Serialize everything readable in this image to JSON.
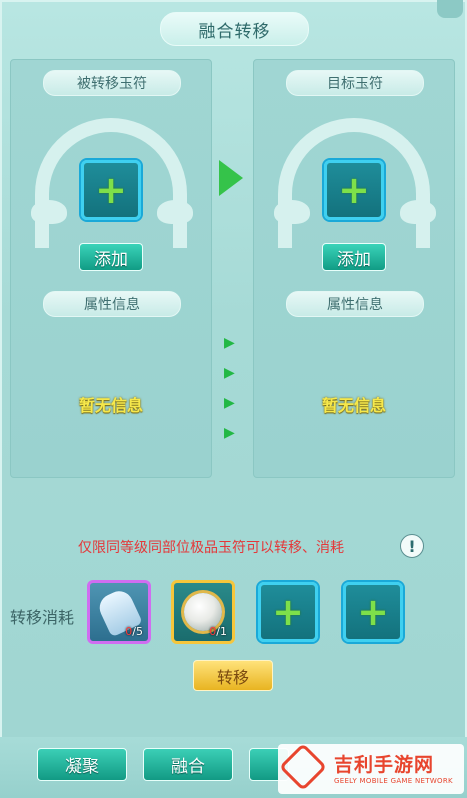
{
  "window": {
    "title": "融合转移"
  },
  "left_panel": {
    "header": "被转移玉符",
    "add_label": "添加",
    "attr_header": "属性信息",
    "empty_text": "暂无信息"
  },
  "right_panel": {
    "header": "目标玉符",
    "add_label": "添加",
    "attr_header": "属性信息",
    "empty_text": "暂无信息"
  },
  "hint": {
    "text": "仅限同等级同部位极品玉符可以转移、消耗"
  },
  "cost": {
    "label": "转移消耗",
    "items": [
      {
        "icon": "vial-icon",
        "have": "0",
        "need": "/5"
      },
      {
        "icon": "orb-icon",
        "have": "0",
        "need": "/1"
      }
    ]
  },
  "action": {
    "transfer_label": "转移"
  },
  "tabs": [
    {
      "label": "凝聚"
    },
    {
      "label": "融合"
    }
  ],
  "watermark": {
    "title": "吉利手游网",
    "subtitle": "GEELY MOBILE GAME NETWORK"
  },
  "colors": {
    "accent": "#3ad3b9",
    "hint": "#e4383a",
    "empty": "#f6e84b",
    "button_gold": "#f0c33a"
  }
}
